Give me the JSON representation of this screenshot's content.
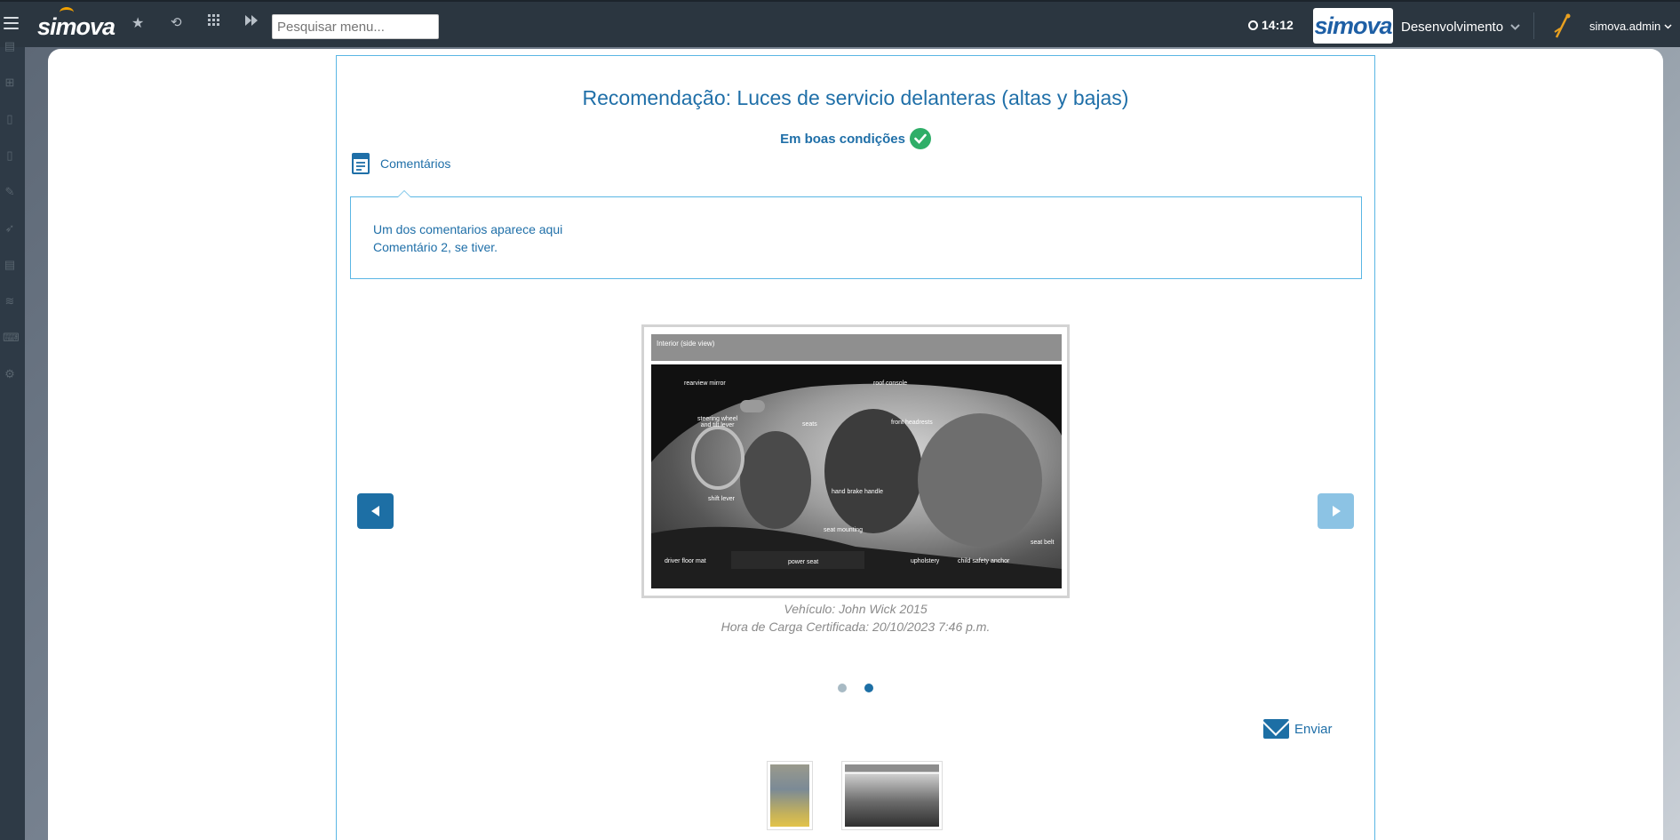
{
  "topbar": {
    "logo_text": "simova",
    "search_placeholder": "Pesquisar menu...",
    "time": "14:12",
    "env_logo_text": "simova",
    "environment": "Desenvolvimento",
    "user": "simova.admin"
  },
  "recommendation": {
    "title": "Recomendação: Luces de servicio delanteras (altas y bajas)",
    "status": "Em boas condições",
    "comments_tab": "Comentários",
    "comments": [
      "Um dos comentarios aparece aqui",
      "Comentário 2, se tiver."
    ]
  },
  "image": {
    "header": "Interior (side view)",
    "labels": {
      "rearview_mirror": "rearview mirror",
      "roof_console": "roof console",
      "steering_wheel": "steering wheel\nand tilt lever",
      "seats": "seats",
      "front_headrests": "front headrests",
      "shift_lever": "shift lever",
      "hand_brake": "hand brake handle",
      "seat_mounting": "seat mounting",
      "seat_belt": "seat belt",
      "driver_floor_mat": "driver floor mat",
      "power_seat": "power seat",
      "upholstery": "upholstery",
      "child_safety_anchor": "child safety anchor"
    }
  },
  "caption": {
    "vehicle": "Vehículo: John Wick 2015",
    "certified_time": "Hora de Carga Certificada: 20/10/2023 7:46 p.m."
  },
  "actions": {
    "send": "Enviar"
  },
  "colors": {
    "topbar": "#2b3640",
    "accent": "#1f6fa8",
    "border": "#5ab6e4",
    "status_green": "#2fae68"
  }
}
